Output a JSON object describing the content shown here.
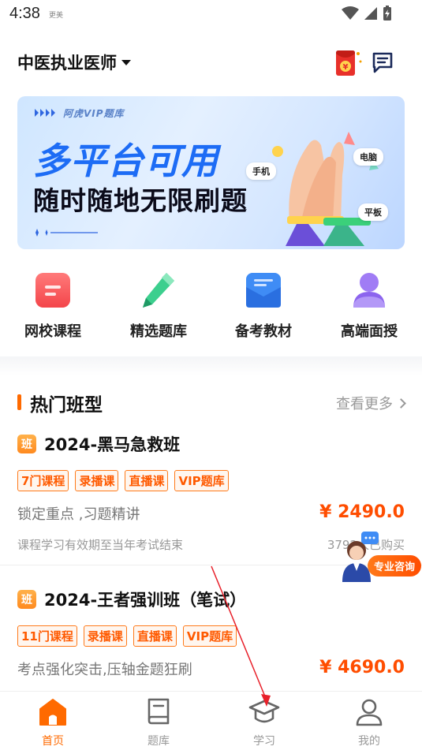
{
  "status": {
    "time": "4:38",
    "note": "更美"
  },
  "header": {
    "exam": "中医执业医师",
    "redpacket_symbol": "¥"
  },
  "banner": {
    "tag": "阿虎VIP题库",
    "title1": "多平台可用",
    "title2": "随时随地无限刷题",
    "bubbles": {
      "phone": "手机",
      "computer": "电脑",
      "tablet": "平板"
    }
  },
  "quicknav": [
    {
      "label": "网校课程",
      "icon": "course-icon"
    },
    {
      "label": "精选题库",
      "icon": "pencil-icon"
    },
    {
      "label": "备考教材",
      "icon": "book-icon"
    },
    {
      "label": "高端面授",
      "icon": "teacher-icon"
    }
  ],
  "hot": {
    "title": "热门班型",
    "more": "查看更多"
  },
  "courses": [
    {
      "badge": "班",
      "title": "2024-黑马急救班",
      "tags": [
        "7门课程",
        "录播课",
        "直播课",
        "VIP题库"
      ],
      "desc": "锁定重点 ,习题精讲",
      "price": "¥ 2490.0",
      "meta": "课程学习有效期至当年考试结束",
      "buyers": "3792人已购买"
    },
    {
      "badge": "班",
      "title": "2024-王者强训班（笔试）",
      "tags": [
        "11门课程",
        "录播课",
        "直播课",
        "VIP题库"
      ],
      "desc": "考点强化突击,压轴金题狂刷",
      "price": "¥ 4690.0"
    }
  ],
  "consult": {
    "label": "专业咨询"
  },
  "bottom_nav": [
    {
      "label": "首页",
      "icon": "home-icon",
      "active": true
    },
    {
      "label": "题库",
      "icon": "question-bank-icon",
      "active": false
    },
    {
      "label": "学习",
      "icon": "study-cap-icon",
      "active": false
    },
    {
      "label": "我的",
      "icon": "profile-icon",
      "active": false
    }
  ],
  "colors": {
    "accent": "#ff6a00",
    "price": "#ff4d00",
    "banner_blue": "#1d6cf5"
  }
}
